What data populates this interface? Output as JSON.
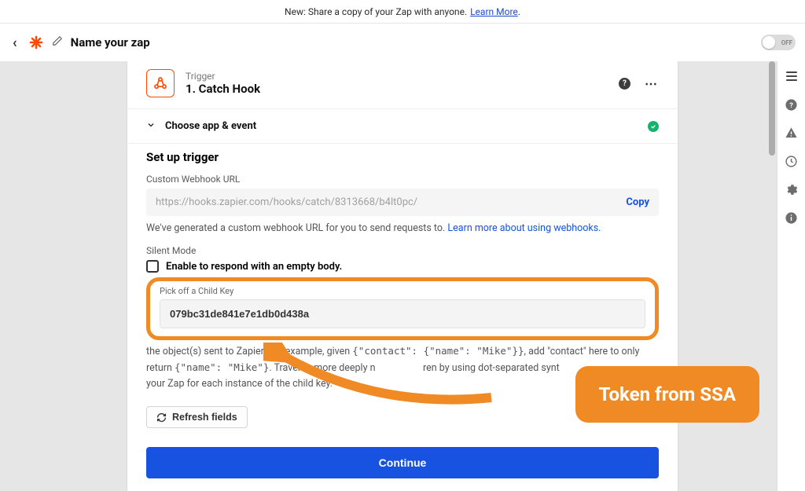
{
  "announcement": {
    "text": "New: Share a copy of your Zap with anyone.",
    "link_label": "Learn More"
  },
  "topbar": {
    "zap_name": "Name your zap",
    "toggle_label": "OFF"
  },
  "step": {
    "type_label": "Trigger",
    "title": "1. Catch Hook"
  },
  "accordion": {
    "choose_label": "Choose app & event"
  },
  "body": {
    "setup_heading": "Set up trigger",
    "url_label": "Custom Webhook URL",
    "url_value": "https://hooks.zapier.com/hooks/catch/8313668/b4lt0pc/",
    "copy_label": "Copy",
    "url_hint_pre": "We've generated a custom webhook URL for you to send requests to. ",
    "url_hint_link": "Learn more about using webhooks.",
    "silent_label": "Silent Mode",
    "silent_text": "Enable to respond with an empty body.",
    "childkey_label": "Pick off a Child Key",
    "childkey_value": "079bc31de841e7e1db0d438a",
    "explanation_pre": "the object(s) sent to Zapier. For example, given ",
    "explanation_code1": "{\"contact\": {\"name\": \"Mike\"}}",
    "explanation_mid": ", add \"contact\" here to only return ",
    "explanation_code2": "{\"name\": \"Mike\"}",
    "explanation_post1": ". Traverse more deeply n",
    "explanation_post2": "ren by using dot-separated synt",
    "explanation_post3": "your Zap for each instance of the child key.",
    "refresh_label": "Refresh fields",
    "continue_label": "Continue"
  },
  "callout": {
    "text": "Token from SSA"
  },
  "icons": {
    "back": "chevron-left-icon",
    "logo": "zapier-logo-icon",
    "pencil": "pencil-icon",
    "help": "help-icon",
    "more": "more-icon",
    "check": "check-icon",
    "refresh": "refresh-icon"
  }
}
